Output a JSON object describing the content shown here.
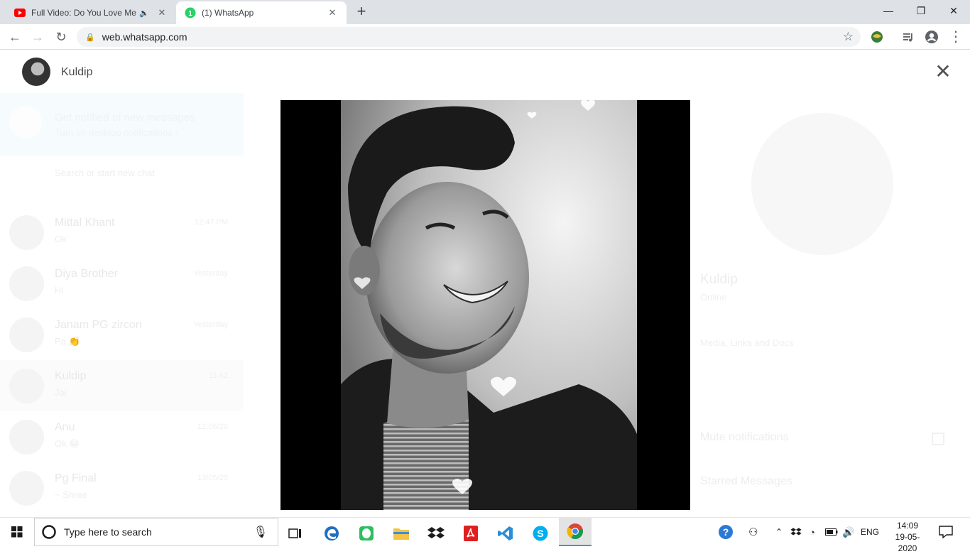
{
  "browser": {
    "tabs": [
      {
        "title": "Full Video: Do You Love Me |",
        "active": false,
        "audio": true
      },
      {
        "title": "(1) WhatsApp",
        "active": true,
        "badge": "1"
      }
    ],
    "new_tab": "+",
    "url": "web.whatsapp.com",
    "colors": {
      "tabstrip": "#dee1e6",
      "whatsapp_green": "#25d366",
      "youtube_red": "#ff0000"
    }
  },
  "viewer": {
    "contact_name": "Kuldip",
    "close_label": "✕"
  },
  "background_chat_list": {
    "notification": {
      "title": "Get notified of new messages",
      "subtitle": "Turn on desktop notifications ›"
    },
    "search_placeholder": "Search or start new chat",
    "chats": [
      {
        "name": "Mittal Khant",
        "message": "Ok",
        "time": "12:47 PM"
      },
      {
        "name": "Diya Brother",
        "message": "Hi",
        "time": "Yesterday"
      },
      {
        "name": "Janam PG zircon",
        "message": "Pa 👏",
        "time": "Yesterday"
      },
      {
        "name": "Kuldip",
        "message": "Jai",
        "time": "11:42"
      },
      {
        "name": "Anu",
        "message": "Ok 😂",
        "time": "12:06/20"
      },
      {
        "name": "Pg Final",
        "message": "~ Shree",
        "time": "13/05/20"
      }
    ]
  },
  "background_contact_panel": {
    "name": "Kuldip",
    "about": "Online",
    "media_label": "Media, Links and Docs",
    "mute_label": "Mute notifications",
    "starred_label": "Starred Messages"
  },
  "taskbar": {
    "search_placeholder": "Type here to search",
    "language": "ENG",
    "time": "14:09",
    "date": "19-05-2020",
    "apps": [
      "task-view",
      "edge",
      "evernote",
      "file-explorer",
      "dropbox",
      "acrobat",
      "vscode",
      "skype",
      "chrome"
    ]
  }
}
